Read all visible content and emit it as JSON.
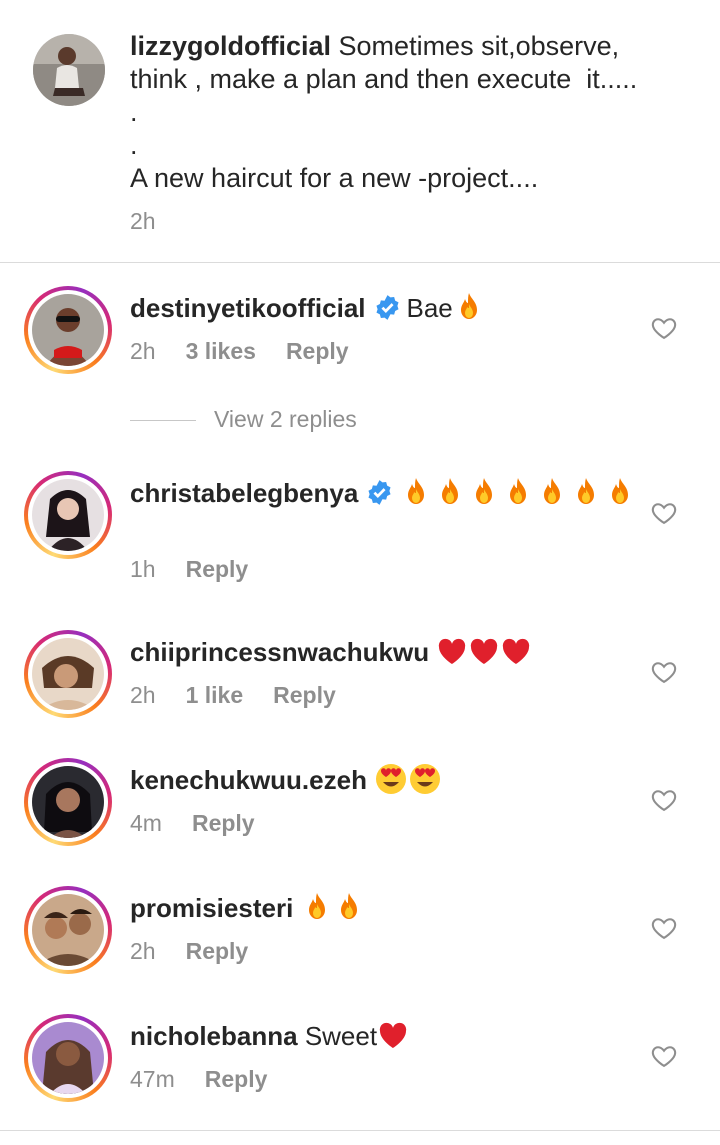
{
  "post": {
    "username": "lizzygoldofficial",
    "caption_lines": [
      "Sometimes sit,observe,",
      "think , make a plan and then execute  it.....",
      ".",
      ".",
      "A new haircut for a new -project...."
    ],
    "time": "2h"
  },
  "view_replies": "View 2 replies",
  "comments": [
    {
      "username": "destinyetikoofficial",
      "verified": true,
      "text": "Bae",
      "emoji": [
        "fire"
      ],
      "time": "2h",
      "likes": "3 likes",
      "reply": "Reply",
      "avatar_color": "#8b4a3a"
    },
    {
      "username": "christabelegbenya",
      "verified": true,
      "text": "",
      "emoji": [
        "fire",
        "fire",
        "fire",
        "fire",
        "fire",
        "fire",
        "fire"
      ],
      "time": "1h",
      "likes": "",
      "reply": "Reply",
      "avatar_color": "#3a2a2e"
    },
    {
      "username": "chiiprincessnwachukwu",
      "verified": false,
      "text": "",
      "emoji": [
        "heart",
        "heart",
        "heart"
      ],
      "time": "2h",
      "likes": "1 like",
      "reply": "Reply",
      "avatar_color": "#c79a7a"
    },
    {
      "username": "kenechukwuu.ezeh",
      "verified": false,
      "text": "",
      "emoji": [
        "heart-eyes",
        "heart-eyes"
      ],
      "time": "4m",
      "likes": "",
      "reply": "Reply",
      "avatar_color": "#2b1f26"
    },
    {
      "username": "promisiesteri",
      "verified": false,
      "text": "",
      "emoji": [
        "fire",
        "fire"
      ],
      "time": "2h",
      "likes": "",
      "reply": "Reply",
      "avatar_color": "#8a5a3c"
    },
    {
      "username": "nicholebanna",
      "verified": false,
      "text": "Sweet",
      "emoji": [
        "heart"
      ],
      "time": "47m",
      "likes": "",
      "reply": "Reply",
      "avatar_color": "#7a5aa6"
    }
  ],
  "colors": {
    "text": "#262626",
    "muted": "#8e8e8e",
    "verified": "#3897f0",
    "heart_red": "#e0202c",
    "divider": "#dbdbdb"
  },
  "icons": {
    "like": "heart-outline-icon",
    "verified": "verified-badge-icon"
  }
}
